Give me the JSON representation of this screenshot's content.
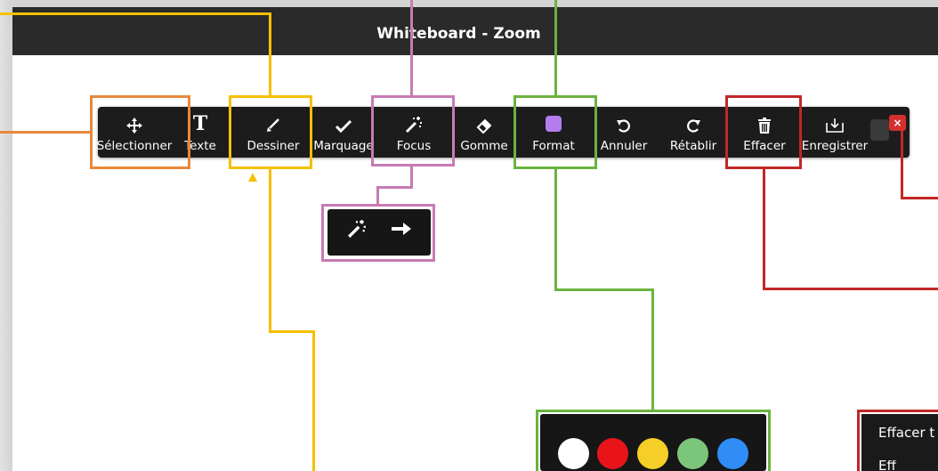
{
  "window": {
    "title": "Whiteboard - Zoom"
  },
  "toolbar": {
    "tools": [
      {
        "label": "Sélectionner",
        "icon": "move-icon"
      },
      {
        "label": "Texte",
        "icon": "text-icon",
        "glyph": "T"
      },
      {
        "label": "Dessiner",
        "icon": "pen-icon"
      },
      {
        "label": "Marquage",
        "icon": "check-icon"
      },
      {
        "label": "Focus",
        "icon": "magic-wand-icon"
      },
      {
        "label": "Gomme",
        "icon": "eraser-icon"
      },
      {
        "label": "Format",
        "icon": "color-swatch-icon"
      },
      {
        "label": "Annuler",
        "icon": "undo-icon"
      },
      {
        "label": "Rétablir",
        "icon": "redo-icon"
      },
      {
        "label": "Effacer",
        "icon": "trash-icon"
      },
      {
        "label": "Enregistrer",
        "icon": "save-icon"
      }
    ],
    "close_glyph": "×"
  },
  "focus_popup": {
    "items": [
      "magic-wand-icon",
      "arrow-right-icon"
    ]
  },
  "format_popup": {
    "colors": [
      "#ffffff",
      "#e8141a",
      "#f5cf27",
      "#7bc67b",
      "#2f8df5"
    ]
  },
  "clear_popup": {
    "item1": "Effacer t",
    "item2": "Eff"
  },
  "colors": {
    "orange": "#e8883a",
    "yellow": "#f5c000",
    "pink": "#c77bb3",
    "green": "#6bb33f",
    "red": "#c02828",
    "format_swatch": "#b57cf0"
  }
}
